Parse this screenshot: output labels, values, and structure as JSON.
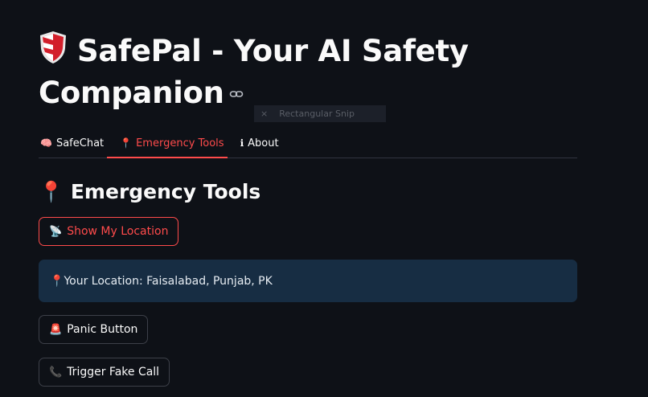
{
  "header": {
    "title": "SafePal - Your AI Safety Companion",
    "shield_icon": "shield-icon",
    "link_icon": "link-icon"
  },
  "overlay": {
    "label": "Rectangular Snip",
    "close_glyph": "×"
  },
  "tabs": [
    {
      "icon": "🧠",
      "label": "SafeChat",
      "active": false
    },
    {
      "icon": "📍",
      "label": "Emergency Tools",
      "active": true
    },
    {
      "icon": "ℹ",
      "label": "About",
      "active": false
    }
  ],
  "section": {
    "icon": "📍",
    "title": "Emergency Tools"
  },
  "buttons": {
    "location": {
      "icon": "📡",
      "label": "Show My Location"
    },
    "panic": {
      "icon": "🚨",
      "label": "Panic Button"
    },
    "fake_call": {
      "icon": "📞",
      "label": "Trigger Fake Call"
    }
  },
  "location_info": {
    "icon": "📍",
    "text": "Your Location: Faisalabad, Punjab, PK"
  },
  "colors": {
    "background": "#0e1117",
    "accent": "#ff4b4b",
    "info_bg": "#172d43",
    "border": "#3d4049"
  }
}
